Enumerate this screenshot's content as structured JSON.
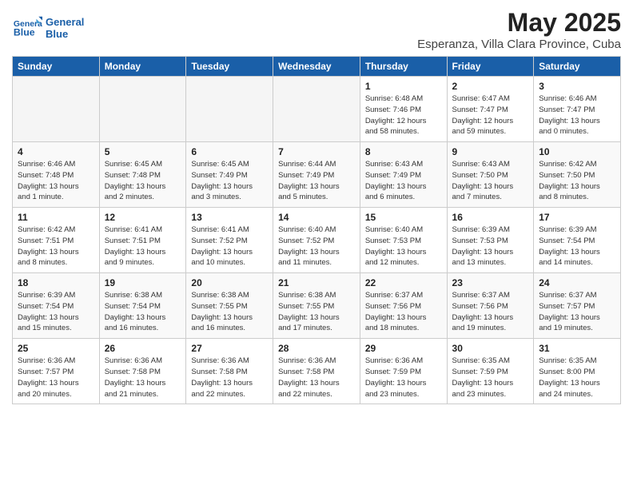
{
  "logo": {
    "text_general": "General",
    "text_blue": "Blue"
  },
  "title": "May 2025",
  "subtitle": "Esperanza, Villa Clara Province, Cuba",
  "weekdays": [
    "Sunday",
    "Monday",
    "Tuesday",
    "Wednesday",
    "Thursday",
    "Friday",
    "Saturday"
  ],
  "weeks": [
    [
      {
        "day": "",
        "info": ""
      },
      {
        "day": "",
        "info": ""
      },
      {
        "day": "",
        "info": ""
      },
      {
        "day": "",
        "info": ""
      },
      {
        "day": "1",
        "info": "Sunrise: 6:48 AM\nSunset: 7:46 PM\nDaylight: 12 hours\nand 58 minutes."
      },
      {
        "day": "2",
        "info": "Sunrise: 6:47 AM\nSunset: 7:47 PM\nDaylight: 12 hours\nand 59 minutes."
      },
      {
        "day": "3",
        "info": "Sunrise: 6:46 AM\nSunset: 7:47 PM\nDaylight: 13 hours\nand 0 minutes."
      }
    ],
    [
      {
        "day": "4",
        "info": "Sunrise: 6:46 AM\nSunset: 7:48 PM\nDaylight: 13 hours\nand 1 minute."
      },
      {
        "day": "5",
        "info": "Sunrise: 6:45 AM\nSunset: 7:48 PM\nDaylight: 13 hours\nand 2 minutes."
      },
      {
        "day": "6",
        "info": "Sunrise: 6:45 AM\nSunset: 7:49 PM\nDaylight: 13 hours\nand 3 minutes."
      },
      {
        "day": "7",
        "info": "Sunrise: 6:44 AM\nSunset: 7:49 PM\nDaylight: 13 hours\nand 5 minutes."
      },
      {
        "day": "8",
        "info": "Sunrise: 6:43 AM\nSunset: 7:49 PM\nDaylight: 13 hours\nand 6 minutes."
      },
      {
        "day": "9",
        "info": "Sunrise: 6:43 AM\nSunset: 7:50 PM\nDaylight: 13 hours\nand 7 minutes."
      },
      {
        "day": "10",
        "info": "Sunrise: 6:42 AM\nSunset: 7:50 PM\nDaylight: 13 hours\nand 8 minutes."
      }
    ],
    [
      {
        "day": "11",
        "info": "Sunrise: 6:42 AM\nSunset: 7:51 PM\nDaylight: 13 hours\nand 8 minutes."
      },
      {
        "day": "12",
        "info": "Sunrise: 6:41 AM\nSunset: 7:51 PM\nDaylight: 13 hours\nand 9 minutes."
      },
      {
        "day": "13",
        "info": "Sunrise: 6:41 AM\nSunset: 7:52 PM\nDaylight: 13 hours\nand 10 minutes."
      },
      {
        "day": "14",
        "info": "Sunrise: 6:40 AM\nSunset: 7:52 PM\nDaylight: 13 hours\nand 11 minutes."
      },
      {
        "day": "15",
        "info": "Sunrise: 6:40 AM\nSunset: 7:53 PM\nDaylight: 13 hours\nand 12 minutes."
      },
      {
        "day": "16",
        "info": "Sunrise: 6:39 AM\nSunset: 7:53 PM\nDaylight: 13 hours\nand 13 minutes."
      },
      {
        "day": "17",
        "info": "Sunrise: 6:39 AM\nSunset: 7:54 PM\nDaylight: 13 hours\nand 14 minutes."
      }
    ],
    [
      {
        "day": "18",
        "info": "Sunrise: 6:39 AM\nSunset: 7:54 PM\nDaylight: 13 hours\nand 15 minutes."
      },
      {
        "day": "19",
        "info": "Sunrise: 6:38 AM\nSunset: 7:54 PM\nDaylight: 13 hours\nand 16 minutes."
      },
      {
        "day": "20",
        "info": "Sunrise: 6:38 AM\nSunset: 7:55 PM\nDaylight: 13 hours\nand 16 minutes."
      },
      {
        "day": "21",
        "info": "Sunrise: 6:38 AM\nSunset: 7:55 PM\nDaylight: 13 hours\nand 17 minutes."
      },
      {
        "day": "22",
        "info": "Sunrise: 6:37 AM\nSunset: 7:56 PM\nDaylight: 13 hours\nand 18 minutes."
      },
      {
        "day": "23",
        "info": "Sunrise: 6:37 AM\nSunset: 7:56 PM\nDaylight: 13 hours\nand 19 minutes."
      },
      {
        "day": "24",
        "info": "Sunrise: 6:37 AM\nSunset: 7:57 PM\nDaylight: 13 hours\nand 19 minutes."
      }
    ],
    [
      {
        "day": "25",
        "info": "Sunrise: 6:36 AM\nSunset: 7:57 PM\nDaylight: 13 hours\nand 20 minutes."
      },
      {
        "day": "26",
        "info": "Sunrise: 6:36 AM\nSunset: 7:58 PM\nDaylight: 13 hours\nand 21 minutes."
      },
      {
        "day": "27",
        "info": "Sunrise: 6:36 AM\nSunset: 7:58 PM\nDaylight: 13 hours\nand 22 minutes."
      },
      {
        "day": "28",
        "info": "Sunrise: 6:36 AM\nSunset: 7:58 PM\nDaylight: 13 hours\nand 22 minutes."
      },
      {
        "day": "29",
        "info": "Sunrise: 6:36 AM\nSunset: 7:59 PM\nDaylight: 13 hours\nand 23 minutes."
      },
      {
        "day": "30",
        "info": "Sunrise: 6:35 AM\nSunset: 7:59 PM\nDaylight: 13 hours\nand 23 minutes."
      },
      {
        "day": "31",
        "info": "Sunrise: 6:35 AM\nSunset: 8:00 PM\nDaylight: 13 hours\nand 24 minutes."
      }
    ]
  ]
}
